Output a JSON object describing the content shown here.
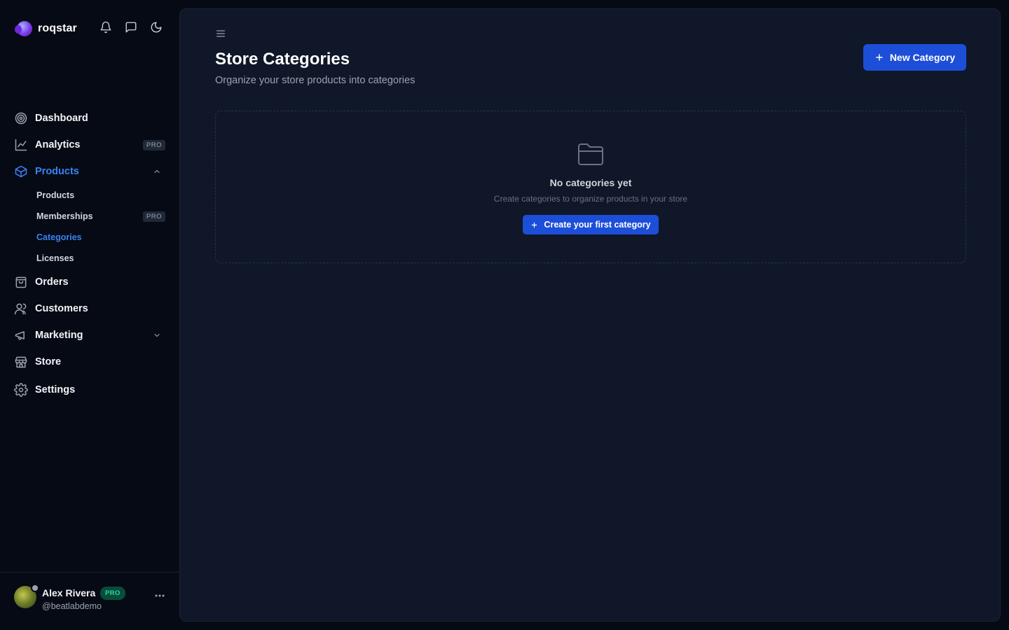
{
  "brand": {
    "name": "roqstar"
  },
  "top_icons": [
    "bell-icon",
    "message-icon",
    "moon-icon"
  ],
  "nav": {
    "dashboard": "Dashboard",
    "analytics": "Analytics",
    "analytics_badge": "PRO",
    "products": "Products",
    "products_sub": {
      "products": "Products",
      "memberships": "Memberships",
      "memberships_badge": "PRO",
      "categories": "Categories",
      "licenses": "Licenses"
    },
    "orders": "Orders",
    "customers": "Customers",
    "marketing": "Marketing",
    "store": "Store",
    "settings": "Settings"
  },
  "user": {
    "name": "Alex Rivera",
    "badge": "PRO",
    "handle": "@beatlabdemo"
  },
  "page": {
    "title": "Store Categories",
    "subtitle": "Organize your store products into categories",
    "new_button": "New Category"
  },
  "empty_state": {
    "title": "No categories yet",
    "description": "Create categories to organize products in your store",
    "button": "Create your first category"
  },
  "colors": {
    "accent": "#3b82f6",
    "button": "#1d4ed8",
    "background": "#0f1728",
    "sidebar": "#060a14",
    "pro_badge_text": "#34d399"
  }
}
